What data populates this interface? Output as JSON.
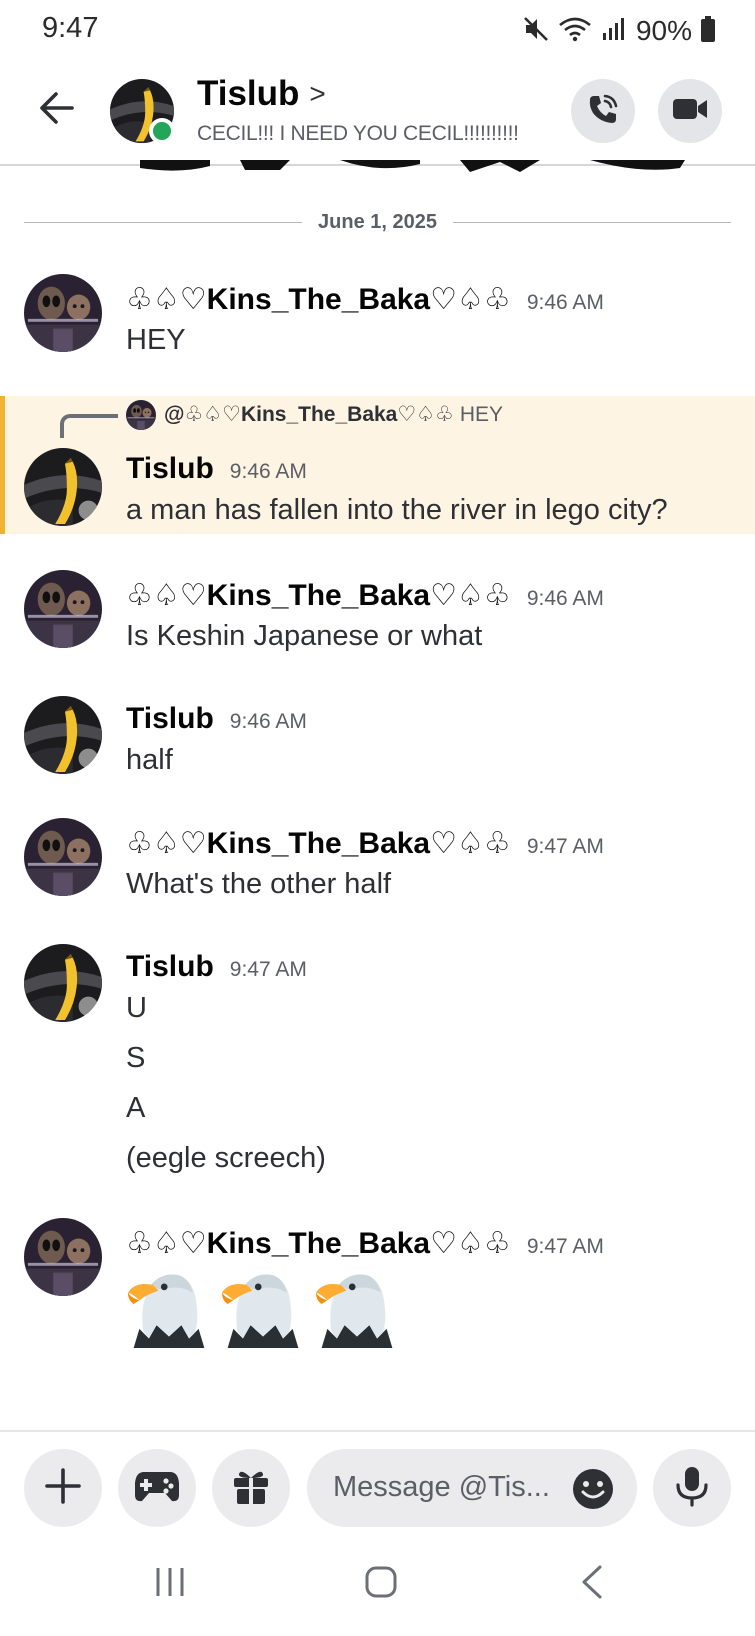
{
  "status_bar": {
    "time": "9:47",
    "battery": "90%",
    "icons": [
      "mute-icon",
      "wifi-icon",
      "signal-icon",
      "battery-icon"
    ]
  },
  "header": {
    "name": "Tislub",
    "chevron": ">",
    "status_text": "CECIL!!! I NEED YOU CECIL!!!!!!!!!!",
    "online_color": "#23a55a"
  },
  "date_divider": "June 1, 2025",
  "messages": [
    {
      "author": "♧♤♡Kins_The_Baka♡♤♧",
      "time": "9:46 AM",
      "lines": [
        "HEY"
      ]
    },
    {
      "author": "Tislub",
      "time": "9:46 AM",
      "reply": {
        "author": "@♧♤♡Kins_The_Baka♡♤♧",
        "text": "HEY"
      },
      "lines": [
        "a man has fallen into the river in lego city?"
      ]
    },
    {
      "author": "♧♤♡Kins_The_Baka♡♤♧",
      "time": "9:46 AM",
      "lines": [
        "Is Keshin Japanese or what"
      ]
    },
    {
      "author": "Tislub",
      "time": "9:46 AM",
      "lines": [
        "half"
      ]
    },
    {
      "author": "♧♤♡Kins_The_Baka♡♤♧",
      "time": "9:47 AM",
      "lines": [
        "What's the other half"
      ]
    },
    {
      "author": "Tislub",
      "time": "9:47 AM",
      "lines": [
        "U",
        "S",
        "A",
        "(eegle screech)"
      ]
    },
    {
      "author": "♧♤♡Kins_The_Baka♡♤♧",
      "time": "9:47 AM",
      "emoji": [
        "eagle-icon",
        "eagle-icon",
        "eagle-icon"
      ]
    }
  ],
  "composer": {
    "placeholder": "Message @Tis...",
    "buttons": [
      "plus-icon",
      "gamepad-icon",
      "gift-icon",
      "emoji-icon",
      "microphone-icon"
    ]
  },
  "nav_bar": [
    "recent-apps-icon",
    "home-icon",
    "back-icon"
  ],
  "colors": {
    "reply_highlight": "#fdf4e3",
    "reply_bar": "#f0b232",
    "button_bg": "#ebebed"
  }
}
